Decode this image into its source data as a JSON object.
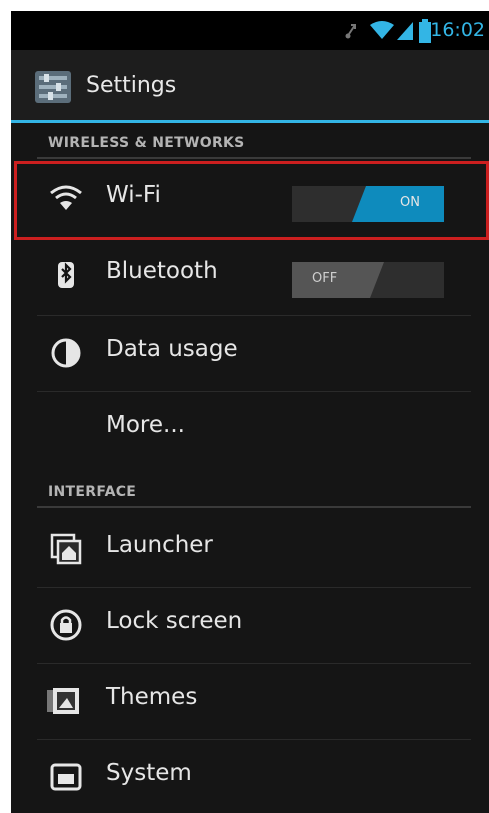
{
  "status_bar": {
    "time": "16:02",
    "icons": [
      "usb-debug-icon",
      "wifi-signal-icon",
      "cell-signal-icon",
      "battery-icon"
    ]
  },
  "action_bar": {
    "title": "Settings",
    "icon": "settings-app-icon"
  },
  "sections": [
    {
      "header": "WIRELESS & NETWORKS",
      "items": [
        {
          "label": "Wi-Fi",
          "icon": "wifi-icon",
          "toggle": "ON",
          "highlighted": true
        },
        {
          "label": "Bluetooth",
          "icon": "bluetooth-icon",
          "toggle": "OFF"
        },
        {
          "label": "Data usage",
          "icon": "data-usage-icon"
        },
        {
          "label": "More..."
        }
      ]
    },
    {
      "header": "INTERFACE",
      "items": [
        {
          "label": "Launcher",
          "icon": "launcher-icon"
        },
        {
          "label": "Lock screen",
          "icon": "lock-icon"
        },
        {
          "label": "Themes",
          "icon": "themes-icon"
        },
        {
          "label": "System",
          "icon": "system-icon"
        }
      ]
    }
  ],
  "colors": {
    "accent": "#33b5e5",
    "toggle_on": "#0e8bbd",
    "highlight": "#cc1f1f",
    "background": "#151515"
  }
}
